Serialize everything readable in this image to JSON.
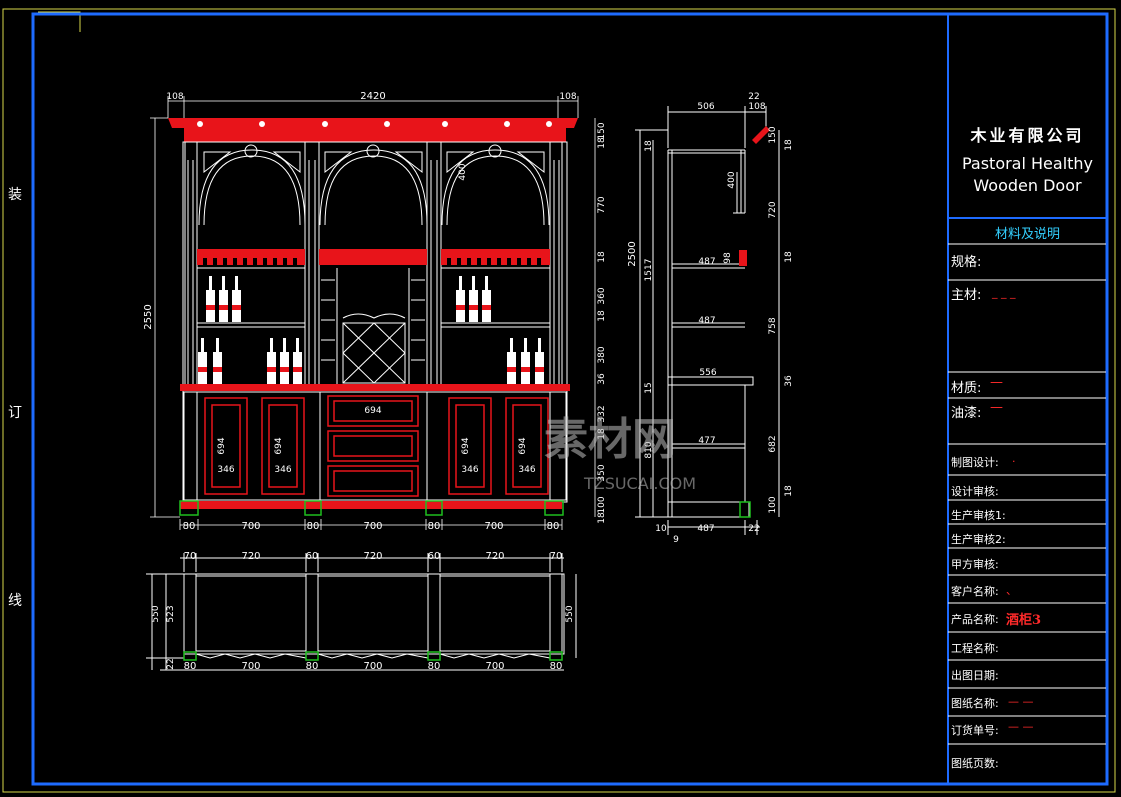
{
  "side_marks": {
    "a": "装",
    "b": "订",
    "c": "线"
  },
  "title_block": {
    "company": "木业有限公司",
    "english_line1": "Pastoral Healthy",
    "english_line2": "Wooden Door",
    "materials_header": "材料及说明",
    "spec_label": "规格:",
    "main_material_label": "主材:",
    "main_material_value": "_ _ _",
    "material_label": "材质:",
    "material_value": "—",
    "paint_label": "油漆:",
    "paint_value": "—",
    "drafter_label": "制图设计:",
    "drafter_value": ".",
    "design_review_label": "设计审核:",
    "prod_review1_label": "生产审核1:",
    "prod_review2_label": "生产审核2:",
    "client_review_label": "甲方审核:",
    "customer_label": "客户名称:",
    "customer_value": "、",
    "product_label": "产品名称:",
    "product_value": "酒柜3",
    "project_label": "工程名称:",
    "date_label": "出图日期:",
    "drawing_name_label": "图纸名称:",
    "drawing_name_value": "— —",
    "order_no_label": "订货单号:",
    "order_no_value": "— —",
    "pages_label": "图纸页数:"
  },
  "front_view": {
    "dims_top": [
      "108",
      "2420",
      "108"
    ],
    "dim_height": "2550",
    "dims_right": [
      "150",
      "18",
      "770",
      "18",
      "360",
      "18",
      "380",
      "36",
      "332",
      "18",
      "350",
      "100",
      "18"
    ],
    "dim_arch": "400",
    "dims_bottom": [
      "80",
      "700",
      "80",
      "700",
      "80",
      "700",
      "80"
    ],
    "door_dims": [
      "694",
      "694",
      "694",
      "694"
    ],
    "door_widths": [
      "346",
      "346",
      "346",
      "346"
    ],
    "drawer_dim": "694"
  },
  "plan_view": {
    "dims_top": [
      "70",
      "720",
      "60",
      "720",
      "60",
      "720",
      "70"
    ],
    "dims_left": [
      "550",
      "523",
      "22"
    ],
    "dim_right": "550",
    "dims_bottom": [
      "80",
      "700",
      "80",
      "700",
      "80",
      "700",
      "80"
    ]
  },
  "side_view": {
    "dims_top": [
      "506",
      "22",
      "108"
    ],
    "dim_height": "2500",
    "dims_left": [
      "18",
      "1517",
      "15",
      "810"
    ],
    "dims_right": [
      "150",
      "18",
      "720",
      "18",
      "758",
      "36",
      "682",
      "100",
      "18"
    ],
    "shelf_labels": [
      "487",
      "487",
      "556",
      "477"
    ],
    "dims_bottom": [
      "10",
      "487",
      "22",
      "9"
    ],
    "small_dims": [
      "400",
      "98"
    ]
  },
  "watermark": {
    "text": "素材网",
    "sub": "TZSUCAI.COM"
  },
  "colors": {
    "frame": "#1e6bff",
    "line": "#ffffff",
    "red": "#e8141a",
    "green": "#1fbf1f",
    "title_cyan": "#33d0ff",
    "ycorner": "#d8d84a"
  }
}
